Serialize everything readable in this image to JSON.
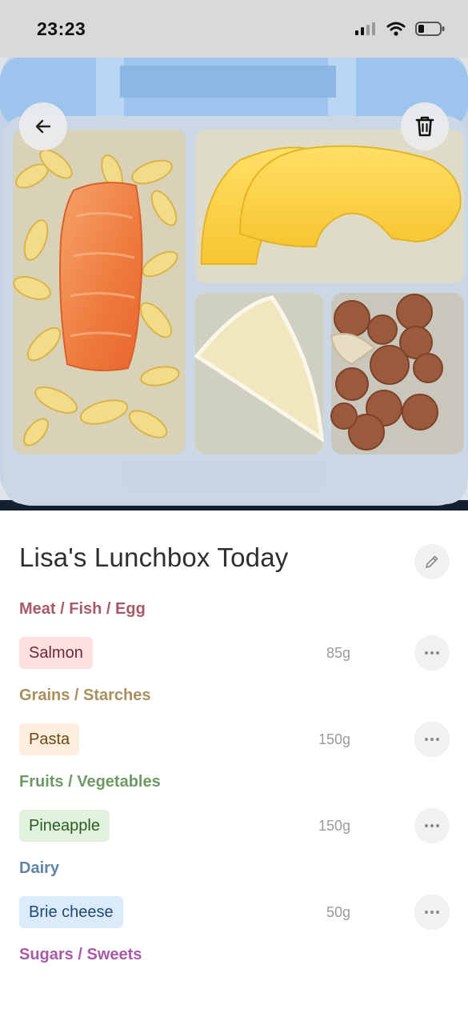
{
  "status_bar": {
    "time": "23:23"
  },
  "hero": {
    "image": "lunchbox-photo"
  },
  "header": {
    "title": "Lisa's Lunchbox Today"
  },
  "colors": {
    "meat": "#a65b67",
    "grains": "#a88f5c",
    "fruits": "#6d9a64",
    "dairy": "#5f84a6",
    "sweets": "#a85aa6"
  },
  "categories": [
    {
      "label": "Meat / Fish / Egg",
      "item": {
        "name": "Salmon",
        "weight": "85g"
      }
    },
    {
      "label": "Grains / Starches",
      "item": {
        "name": "Pasta",
        "weight": "150g"
      }
    },
    {
      "label": "Fruits / Vegetables",
      "item": {
        "name": "Pineapple",
        "weight": "150g"
      }
    },
    {
      "label": "Dairy",
      "item": {
        "name": "Brie cheese",
        "weight": "50g"
      }
    },
    {
      "label": "Sugars / Sweets"
    }
  ]
}
